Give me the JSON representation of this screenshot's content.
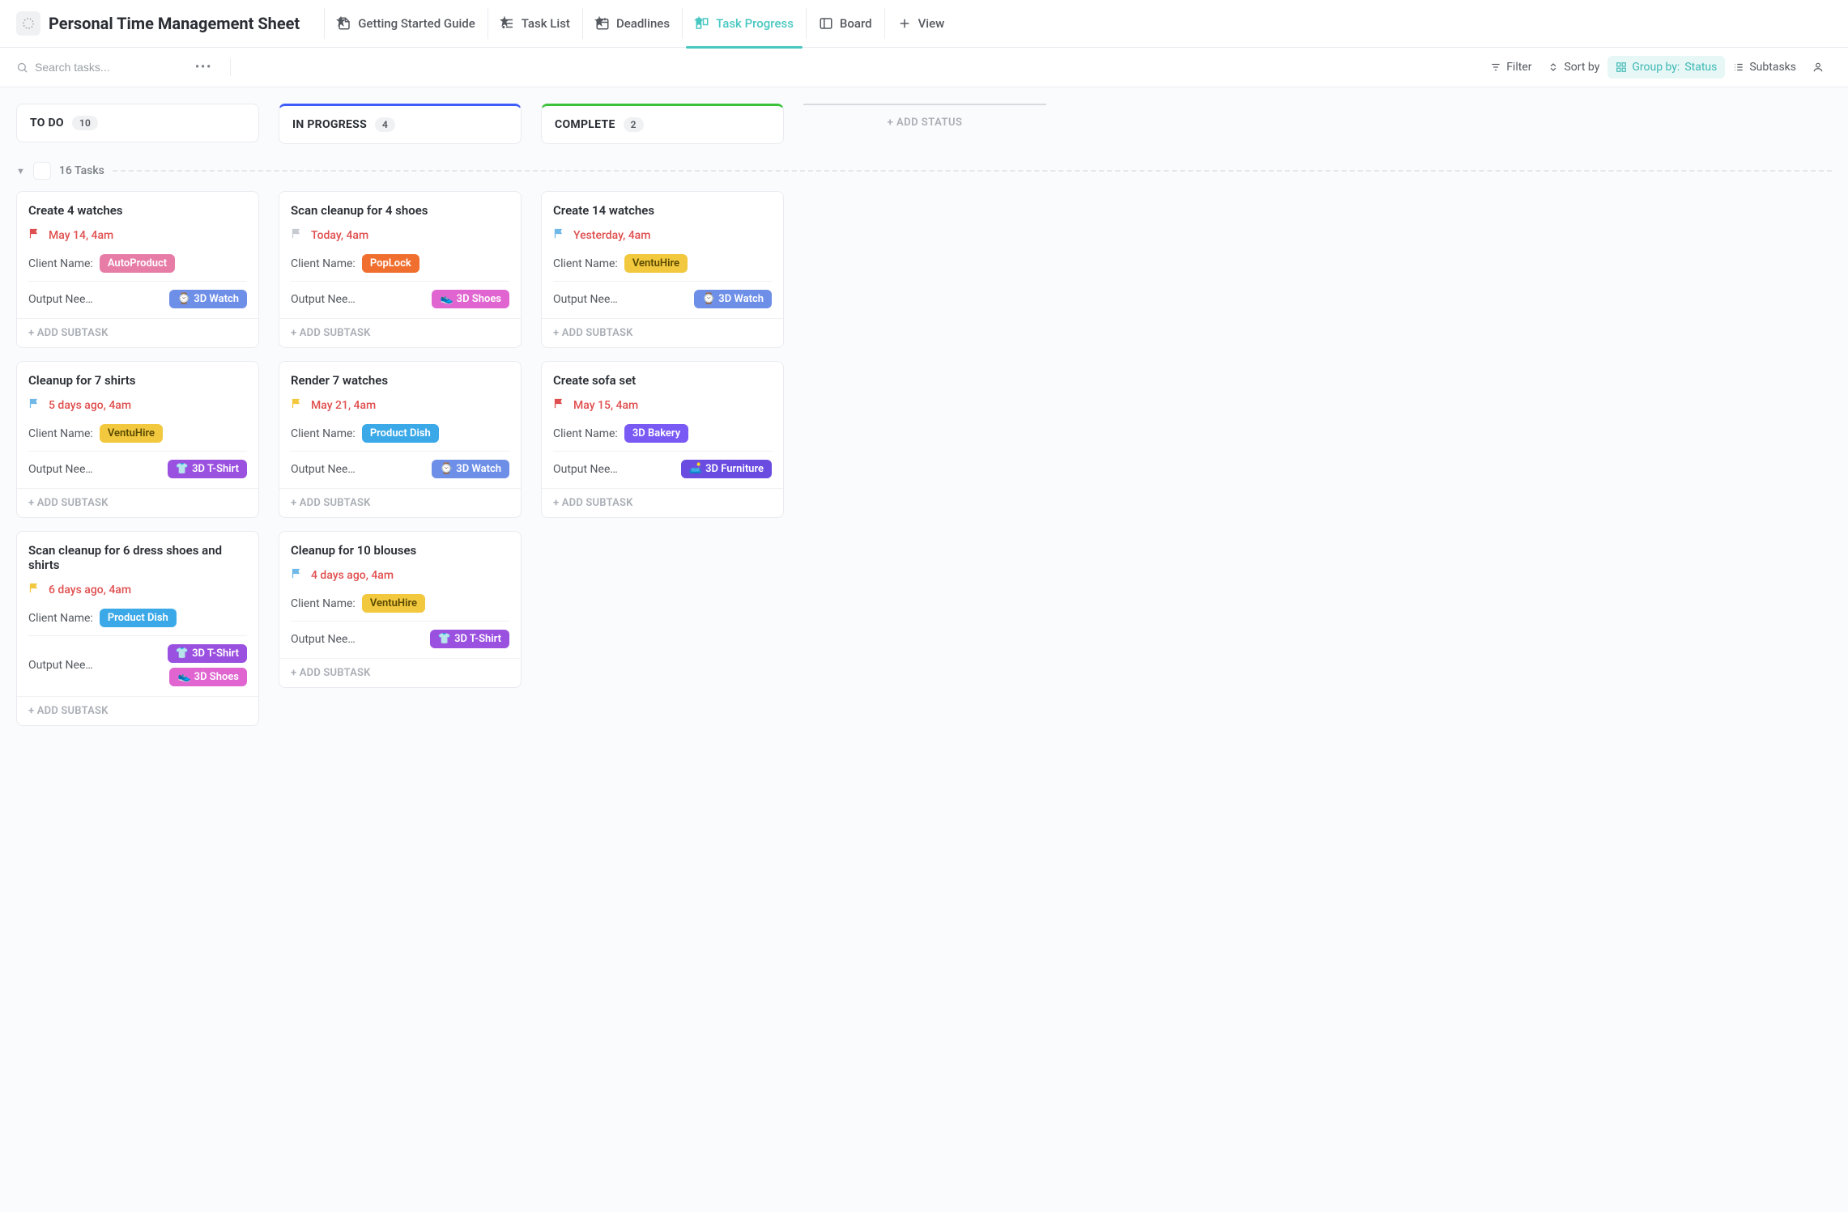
{
  "header": {
    "title": "Personal Time Management Sheet",
    "tabs": [
      {
        "label": "Getting Started Guide",
        "icon": "doc"
      },
      {
        "label": "Task List",
        "icon": "list"
      },
      {
        "label": "Deadlines",
        "icon": "calendar"
      },
      {
        "label": "Task Progress",
        "icon": "board",
        "active": true
      },
      {
        "label": "Board",
        "icon": "board2"
      }
    ],
    "addView": "+  View"
  },
  "toolbar": {
    "searchPlaceholder": "Search tasks...",
    "filter": "Filter",
    "sort": "Sort by",
    "groupLabel": "Group by:",
    "groupValue": "Status",
    "subtasks": "Subtasks"
  },
  "columns": [
    {
      "key": "todo",
      "label": "TO DO",
      "count": "10"
    },
    {
      "key": "inprogress",
      "label": "IN PROGRESS",
      "count": "4"
    },
    {
      "key": "complete",
      "label": "COMPLETE",
      "count": "2"
    }
  ],
  "addStatus": "+ ADD STATUS",
  "group": {
    "label": "16 Tasks"
  },
  "addSubtask": "+ ADD SUBTASK",
  "fieldClient": "Client Name:",
  "fieldOutput": "Output Nee…",
  "clientColors": {
    "AutoProduct": "#e77da7",
    "PopLock": "#f06f2e",
    "VentuHire": "#f2c83f",
    "Product Dish": "#3ba9e8",
    "3D Bakery": "#7a5af5"
  },
  "outputs": {
    "3D Watch": {
      "emoji": "⌚",
      "color": "#6e8fe8"
    },
    "3D Shoes": {
      "emoji": "👟",
      "color": "#e065d1"
    },
    "3D T-Shirt": {
      "emoji": "👕",
      "color": "#9b51e0"
    },
    "3D Furniture": {
      "emoji": "🛋️",
      "color": "#6a4ce0"
    }
  },
  "flagColors": {
    "red": "#e04f4f",
    "gray": "#c7cbd1",
    "blue": "#6fb8e8",
    "yellow": "#f2c83f"
  },
  "cards": {
    "todo": [
      {
        "title": "Create 4 watches",
        "flag": "red",
        "due": "May 14, 4am",
        "client": "AutoProduct",
        "outputs": [
          "3D Watch"
        ]
      },
      {
        "title": "Cleanup for 7 shirts",
        "flag": "blue",
        "due": "5 days ago, 4am",
        "client": "VentuHire",
        "outputs": [
          "3D T-Shirt"
        ]
      },
      {
        "title": "Scan cleanup for 6 dress shoes and shirts",
        "flag": "yellow",
        "due": "6 days ago, 4am",
        "client": "Product Dish",
        "outputs": [
          "3D T-Shirt",
          "3D Shoes"
        ]
      }
    ],
    "inprogress": [
      {
        "title": "Scan cleanup for 4 shoes",
        "flag": "gray",
        "due": "Today, 4am",
        "client": "PopLock",
        "outputs": [
          "3D Shoes"
        ]
      },
      {
        "title": "Render 7 watches",
        "flag": "yellow",
        "due": "May 21, 4am",
        "client": "Product Dish",
        "outputs": [
          "3D Watch"
        ]
      },
      {
        "title": "Cleanup for 10 blouses",
        "flag": "blue",
        "due": "4 days ago, 4am",
        "client": "VentuHire",
        "outputs": [
          "3D T-Shirt"
        ]
      }
    ],
    "complete": [
      {
        "title": "Create 14 watches",
        "flag": "blue",
        "due": "Yesterday, 4am",
        "client": "VentuHire",
        "outputs": [
          "3D Watch"
        ]
      },
      {
        "title": "Create sofa set",
        "flag": "red",
        "due": "May 15, 4am",
        "client": "3D Bakery",
        "outputs": [
          "3D Furniture"
        ]
      }
    ]
  }
}
